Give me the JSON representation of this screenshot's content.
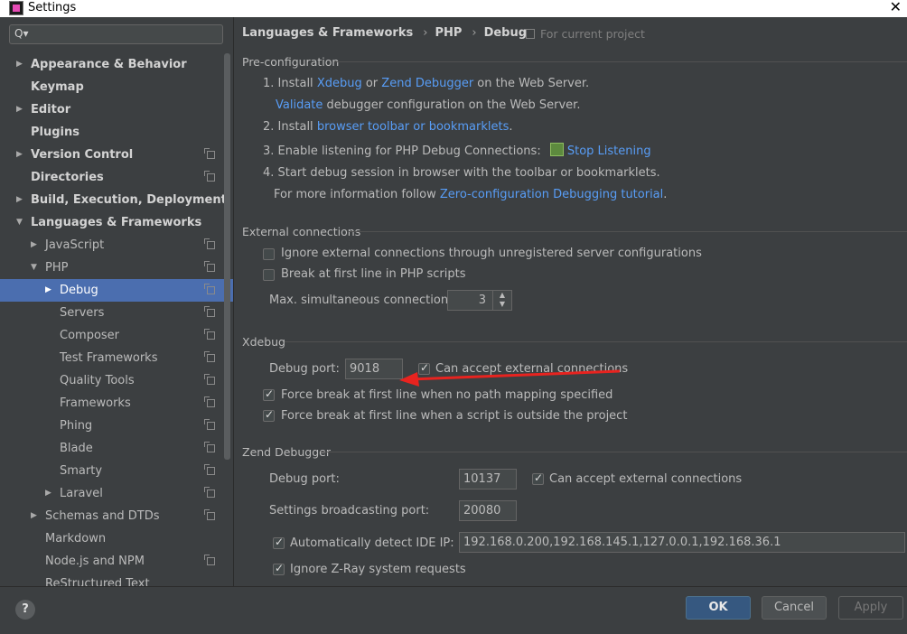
{
  "window": {
    "title": "Settings",
    "close_glyph": "✕"
  },
  "search": {
    "icon": "search-icon",
    "glyph": "Q▾"
  },
  "sidebar": {
    "items": [
      {
        "label": "Appearance & Behavior",
        "arrow": "▶",
        "level": 0,
        "bold": true,
        "copy": false
      },
      {
        "label": "Keymap",
        "arrow": "",
        "level": 0,
        "bold": true,
        "copy": false
      },
      {
        "label": "Editor",
        "arrow": "▶",
        "level": 0,
        "bold": true,
        "copy": false
      },
      {
        "label": "Plugins",
        "arrow": "",
        "level": 0,
        "bold": true,
        "copy": false
      },
      {
        "label": "Version Control",
        "arrow": "▶",
        "level": 0,
        "bold": true,
        "copy": true
      },
      {
        "label": "Directories",
        "arrow": "",
        "level": 0,
        "bold": true,
        "copy": true
      },
      {
        "label": "Build, Execution, Deployment",
        "arrow": "▶",
        "level": 0,
        "bold": true,
        "copy": false
      },
      {
        "label": "Languages & Frameworks",
        "arrow": "▼",
        "level": 0,
        "bold": true,
        "copy": false
      },
      {
        "label": "JavaScript",
        "arrow": "▶",
        "level": 1,
        "bold": false,
        "copy": true
      },
      {
        "label": "PHP",
        "arrow": "▼",
        "level": 1,
        "bold": false,
        "copy": true
      },
      {
        "label": "Debug",
        "arrow": "▶",
        "level": 2,
        "bold": false,
        "copy": true,
        "selected": true
      },
      {
        "label": "Servers",
        "arrow": "",
        "level": 2,
        "bold": false,
        "copy": true
      },
      {
        "label": "Composer",
        "arrow": "",
        "level": 2,
        "bold": false,
        "copy": true
      },
      {
        "label": "Test Frameworks",
        "arrow": "",
        "level": 2,
        "bold": false,
        "copy": true
      },
      {
        "label": "Quality Tools",
        "arrow": "",
        "level": 2,
        "bold": false,
        "copy": true
      },
      {
        "label": "Frameworks",
        "arrow": "",
        "level": 2,
        "bold": false,
        "copy": true
      },
      {
        "label": "Phing",
        "arrow": "",
        "level": 2,
        "bold": false,
        "copy": true
      },
      {
        "label": "Blade",
        "arrow": "",
        "level": 2,
        "bold": false,
        "copy": true
      },
      {
        "label": "Smarty",
        "arrow": "",
        "level": 2,
        "bold": false,
        "copy": true
      },
      {
        "label": "Laravel",
        "arrow": "▶",
        "level": 2,
        "bold": false,
        "copy": true
      },
      {
        "label": "Schemas and DTDs",
        "arrow": "▶",
        "level": 1,
        "bold": false,
        "copy": true
      },
      {
        "label": "Markdown",
        "arrow": "",
        "level": 1,
        "bold": false,
        "copy": false
      },
      {
        "label": "Node.js and NPM",
        "arrow": "",
        "level": 1,
        "bold": false,
        "copy": true
      },
      {
        "label": "ReStructured Text",
        "arrow": "",
        "level": 1,
        "bold": false,
        "copy": false
      }
    ]
  },
  "breadcrumb": {
    "part1": "Languages & Frameworks",
    "part2": "PHP",
    "part3": "Debug",
    "sep": "›"
  },
  "for_project": "For current project",
  "preconfig": {
    "title": "Pre-configuration",
    "step1_prefix": "1. Install ",
    "step1_link1": "Xdebug",
    "step1_or": " or ",
    "step1_link2": "Zend Debugger",
    "step1_suffix": " on the Web Server.",
    "validate_link": "Validate",
    "validate_suffix": " debugger configuration on the Web Server.",
    "step2_prefix": "2. Install ",
    "step2_link": "browser toolbar or bookmarklets",
    "step2_suffix": ".",
    "step3_text": "3. Enable listening for PHP Debug Connections:",
    "step3_link": "Stop Listening",
    "step4_text": "4. Start debug session in browser with the toolbar or bookmarklets.",
    "step4b_prefix": "For more information follow ",
    "step4b_link": "Zero-configuration Debugging tutorial",
    "step4b_suffix": "."
  },
  "external": {
    "title": "External connections",
    "ignore_label": "Ignore external connections through unregistered server configurations",
    "ignore_checked": false,
    "break_label": "Break at first line in PHP scripts",
    "break_checked": false,
    "max_label": "Max. simultaneous connections:",
    "max_value": "3",
    "spinner_glyph": "▲\n▼"
  },
  "xdebug": {
    "title": "Xdebug",
    "port_label": "Debug port:",
    "port_value": "9018",
    "accept_label": "Can accept external connections",
    "accept_checked": true,
    "force1_label": "Force break at first line when no path mapping specified",
    "force1_checked": true,
    "force2_label": "Force break at first line when a script is outside the project",
    "force2_checked": true
  },
  "zend": {
    "title": "Zend Debugger",
    "port_label": "Debug port:",
    "port_value": "10137",
    "accept_label": "Can accept external connections",
    "accept_checked": true,
    "broadcast_label": "Settings broadcasting port:",
    "broadcast_value": "20080",
    "autodetect_label": "Automatically detect IDE IP:",
    "autodetect_checked": true,
    "ip_value": "192.168.0.200,192.168.145.1,127.0.0.1,192.168.36.1",
    "zray_label": "Ignore Z-Ray system requests",
    "zray_checked": true
  },
  "footer": {
    "help": "?",
    "ok": "OK",
    "cancel": "Cancel",
    "apply": "Apply"
  },
  "colors": {
    "accent": "#4b6eaf",
    "link": "#589df6",
    "annotation_arrow": "#e8231f"
  }
}
